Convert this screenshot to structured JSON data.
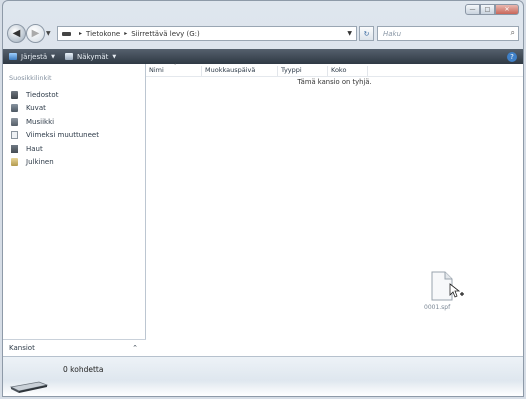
{
  "address": {
    "crumbs": [
      "Tietokone",
      "Siirrettävä levy (G:)"
    ]
  },
  "search": {
    "placeholder": "Haku"
  },
  "toolbar": {
    "organize": "Järjestä",
    "views": "Näkymät"
  },
  "nav": {
    "heading": "Suosikkilinkit",
    "items": [
      {
        "label": "Tiedostot",
        "icon": "documents-icon"
      },
      {
        "label": "Kuvat",
        "icon": "pictures-icon"
      },
      {
        "label": "Musiikki",
        "icon": "music-icon"
      },
      {
        "label": "Viimeksi muuttuneet",
        "icon": "recent-icon"
      },
      {
        "label": "Haut",
        "icon": "searches-icon"
      },
      {
        "label": "Julkinen",
        "icon": "public-icon"
      }
    ],
    "folders_label": "Kansiot"
  },
  "columns": [
    "Nimi",
    "Muokkauspäivä",
    "Tyyppi",
    "Koko"
  ],
  "content": {
    "empty_message": "Tämä kansio on tyhjä.",
    "dragged_file": "0001.spf"
  },
  "details": {
    "count": "0 kohdetta"
  }
}
